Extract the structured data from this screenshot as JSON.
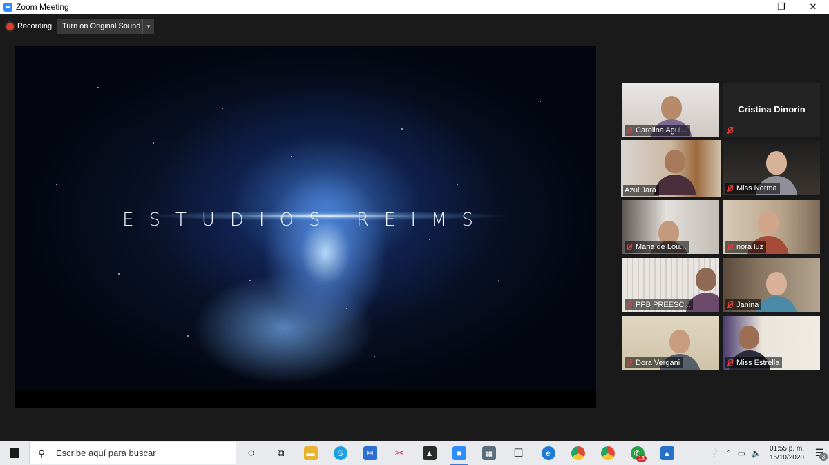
{
  "window": {
    "title": "Zoom Meeting",
    "minimize": "—",
    "restore": "❐",
    "close": "✕"
  },
  "toolbar": {
    "recording_label": "Recording",
    "original_sound_label": "Turn on Original Sound"
  },
  "stage": {
    "title_text": "ESTUDIOS REIMS"
  },
  "participants": [
    {
      "name": "Carolina Agui...",
      "muted": true,
      "video": true
    },
    {
      "name": "Cristina Dinorin",
      "muted": true,
      "video": false
    },
    {
      "name": "Azul Jara",
      "muted": false,
      "video": true,
      "active_speaker": true
    },
    {
      "name": "Miss Norma",
      "muted": true,
      "video": true
    },
    {
      "name": "Maria de Lou...",
      "muted": true,
      "video": true
    },
    {
      "name": "nora luz",
      "muted": true,
      "video": true
    },
    {
      "name": "PPB PREESC...",
      "muted": true,
      "video": true
    },
    {
      "name": "Janina",
      "muted": true,
      "video": true
    },
    {
      "name": "Dora Vergani",
      "muted": true,
      "video": true
    },
    {
      "name": "Miss Estrella",
      "muted": true,
      "video": true
    }
  ],
  "taskbar": {
    "search_placeholder": "Escribe aquí para buscar",
    "apps": [
      {
        "icon": "cortana-icon"
      },
      {
        "icon": "task-view-icon"
      },
      {
        "icon": "file-explorer-icon",
        "color": "#e8b32e"
      },
      {
        "icon": "skype-icon",
        "color": "#1da1e2"
      },
      {
        "icon": "mail-icon",
        "color": "#2a6fd1"
      },
      {
        "icon": "snip-icon",
        "color": "#c84a6a"
      },
      {
        "icon": "photos-icon",
        "color": "#2b2b2b"
      },
      {
        "icon": "zoom-icon",
        "color": "#2d8cff",
        "active": true
      },
      {
        "icon": "calculator-icon",
        "color": "#5a6c7d"
      },
      {
        "icon": "feedback-icon",
        "color": "#3b3b3b"
      },
      {
        "icon": "edge-icon",
        "color": "#1f7bd1"
      },
      {
        "icon": "chrome-icon",
        "color": "#dd4b39"
      },
      {
        "icon": "chrome-icon-2",
        "color": "#dd4b39"
      },
      {
        "icon": "whatsapp-icon",
        "color": "#25a244",
        "badge": "13"
      },
      {
        "icon": "photo-viewer-icon",
        "color": "#2672c8"
      }
    ],
    "time": "01:55 p. m.",
    "date": "15/10/2020",
    "notification_count": "3"
  }
}
